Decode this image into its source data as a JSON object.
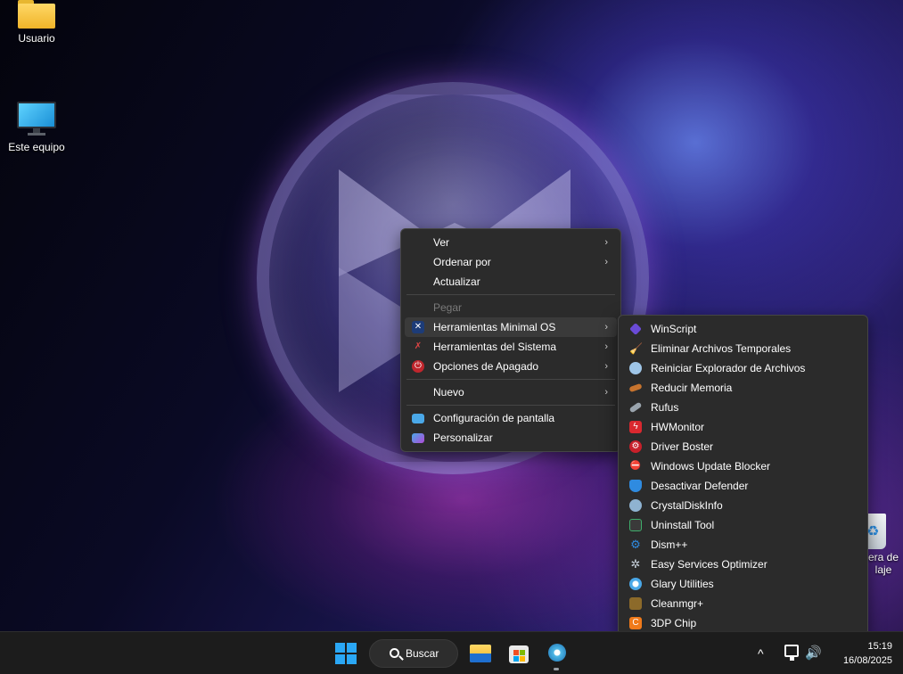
{
  "desktop": {
    "icons": [
      {
        "label": "Usuario"
      },
      {
        "label": "Este equipo"
      }
    ],
    "recycle_bin_label_line1": "era de",
    "recycle_bin_label_line2": "laje"
  },
  "context_menu": {
    "items": [
      {
        "label": "Ver",
        "has_submenu": true
      },
      {
        "label": "Ordenar por",
        "has_submenu": true
      },
      {
        "label": "Actualizar",
        "has_submenu": false
      },
      {
        "label": "Pegar",
        "disabled": true
      },
      {
        "label": "Herramientas Minimal OS",
        "has_submenu": true,
        "icon": "minimal-os-icon"
      },
      {
        "label": "Herramientas del Sistema",
        "has_submenu": true,
        "icon": "tools-icon"
      },
      {
        "label": "Opciones de Apagado",
        "has_submenu": true,
        "icon": "power-icon"
      },
      {
        "label": "Nuevo",
        "has_submenu": true
      },
      {
        "label": "Configuración de pantalla",
        "icon": "display-icon"
      },
      {
        "label": "Personalizar",
        "icon": "personalize-icon"
      }
    ],
    "chevron": "›"
  },
  "submenu": {
    "items": [
      {
        "label": "WinScript",
        "icon": "winscript-icon",
        "color": "#6a4bd6"
      },
      {
        "label": "Eliminar Archivos Temporales",
        "icon": "broom-icon",
        "color": "#e0b23a"
      },
      {
        "label": "Reiniciar Explorador de Archivos",
        "icon": "globe-icon",
        "color": "#9fc6e8"
      },
      {
        "label": "Reducir Memoria",
        "icon": "ram-icon",
        "color": "#c8742e"
      },
      {
        "label": "Rufus",
        "icon": "usb-icon",
        "color": "#9aa4ad"
      },
      {
        "label": "HWMonitor",
        "icon": "hwmonitor-icon",
        "color": "#d9282f"
      },
      {
        "label": "Driver Boster",
        "icon": "driver-booster-icon",
        "color": "#c8202a"
      },
      {
        "label": "Windows Update Blocker",
        "icon": "update-blocker-icon",
        "color": "#d95050"
      },
      {
        "label": "Desactivar Defender",
        "icon": "shield-icon",
        "color": "#2f8be0"
      },
      {
        "label": "CrystalDiskInfo",
        "icon": "disk-icon",
        "color": "#8fb3d1"
      },
      {
        "label": "Uninstall Tool",
        "icon": "uninstall-icon",
        "color": "#3fae6b"
      },
      {
        "label": "Dism++",
        "icon": "gears-icon",
        "color": "#2f8be0"
      },
      {
        "label": "Easy Services Optimizer",
        "icon": "services-icon",
        "color": "#c9d3dd"
      },
      {
        "label": "Glary Utilities",
        "icon": "glary-icon",
        "color": "#4aa8e8"
      },
      {
        "label": "Cleanmgr+",
        "icon": "cleanmgr-icon",
        "color": "#8c6a2a"
      },
      {
        "label": "3DP Chip",
        "icon": "chip-icon",
        "color": "#f07a1a"
      }
    ]
  },
  "taskbar": {
    "search_label": "Buscar",
    "tray_chevron": "^",
    "volume_glyph": "🔊",
    "time": "15:19",
    "date": "16/08/2025"
  }
}
